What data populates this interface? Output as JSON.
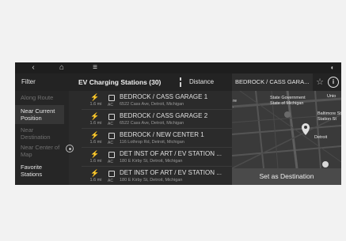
{
  "topbar": {
    "back_icon": "chevron-left-icon",
    "home_icon": "home-icon",
    "menu_icon": "menu-icon",
    "status_icon": "connectivity-icon"
  },
  "header": {
    "filter_label": "Filter",
    "list_title": "EV Charging Stations (30)",
    "sort_label": "Distance",
    "map_title": "BEDROCK / CASS GARA...",
    "favorite_icon": "star-icon",
    "info_label": "i"
  },
  "sidebar": {
    "items": [
      {
        "label": "Along Route",
        "state": "disabled"
      },
      {
        "label": "Near Current Position",
        "state": "selected"
      },
      {
        "label": "Near Destination",
        "state": "disabled"
      },
      {
        "label": "Near Center of Map",
        "state": "disabled"
      },
      {
        "label": "Favorite Stations",
        "state": "active"
      }
    ]
  },
  "stations": [
    {
      "name": "BEDROCK / CASS GARAGE 1",
      "address": "6522 Cass Ave, Detroit, Michigan",
      "distance": "1.6 mi",
      "type": "AC"
    },
    {
      "name": "BEDROCK / CASS GARAGE 2",
      "address": "6522 Cass Ave, Detroit, Michigan",
      "distance": "1.6 mi",
      "type": "AC"
    },
    {
      "name": "BEDROCK / NEW CENTER 1",
      "address": "116 Lothrop Rd, Detroit, Michigan",
      "distance": "1.6 mi",
      "type": "AC"
    },
    {
      "name": "DET INST OF ART / EV STATION ...",
      "address": "180 E Kirby St, Detroit, Michigan",
      "distance": "1.6 mi",
      "type": "AC"
    },
    {
      "name": "DET INST OF ART / EV STATION ...",
      "address": "180 E Kirby St, Detroit, Michigan",
      "distance": "1.6 mi",
      "type": "AC"
    }
  ],
  "map": {
    "labels": {
      "state_gov": "State Government\nState of Michigan",
      "baltimore": "Baltimore St\nStation St",
      "detroit": "Detroit",
      "left_top": "re\n.",
      "right_top": "Unio"
    },
    "destination_button": "Set as Destination"
  },
  "colors": {
    "background": "#2b2b2b",
    "text_primary": "#e0e0e0",
    "text_secondary": "#9a9a9a",
    "button": "#4a4a4a"
  }
}
